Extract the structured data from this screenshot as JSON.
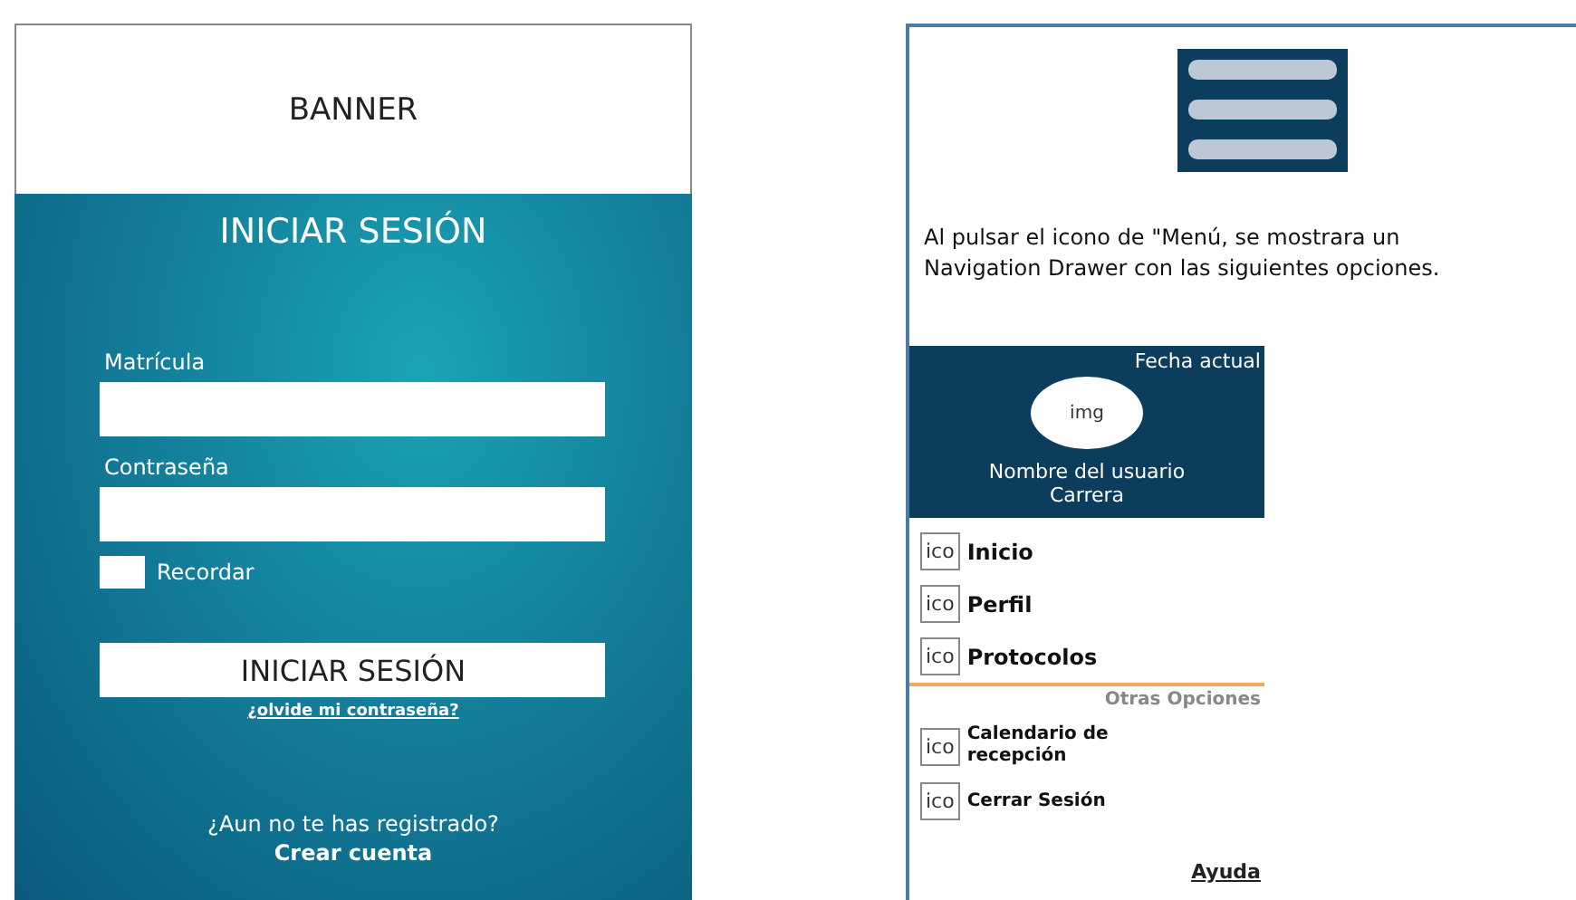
{
  "login": {
    "banner": "BANNER",
    "title": "INICIAR SESIÓN",
    "fields": [
      {
        "label": "Matrícula"
      },
      {
        "label": "Contraseña"
      }
    ],
    "remember": {
      "label": "Recordar",
      "checked": false
    },
    "submit": "INICIAR SESIÓN",
    "forgot_link": "¿olvide mi contraseña?",
    "signup_prompt": "¿Aun no te has registrado?",
    "signup_link": "Crear cuenta"
  },
  "menu_note": {
    "description": "Al pulsar el icono de \"Menú, se mostrara un Navigation Drawer con las siguientes opciones.",
    "drawer": {
      "date": "Fecha actual",
      "avatar": "img",
      "user_name": "Nombre del usuario",
      "career": "Carrera",
      "items": [
        {
          "icon": "ico",
          "label": "Inicio"
        },
        {
          "icon": "ico",
          "label": "Perfil"
        },
        {
          "icon": "ico",
          "label": "Protocolos"
        }
      ],
      "section_title": "Otras Opciones",
      "other_items": [
        {
          "icon": "ico",
          "label": "Calendario de recepción"
        },
        {
          "icon": "ico",
          "label": "Cerrar Sesión"
        }
      ],
      "help_link": "Ayuda"
    }
  }
}
